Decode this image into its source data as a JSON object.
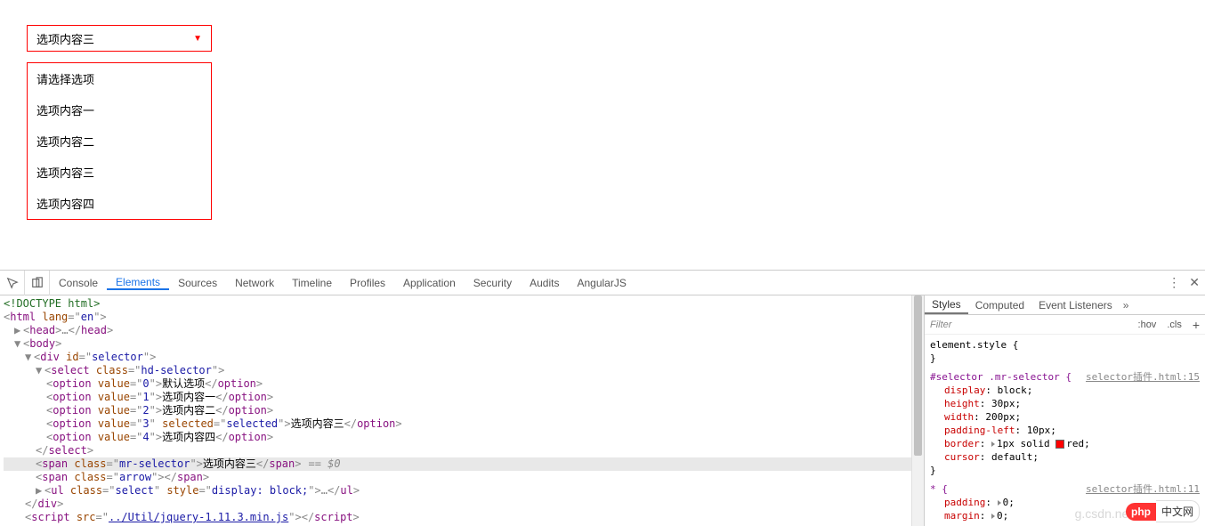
{
  "selector": {
    "selected": "选项内容三",
    "options": [
      "请选择选项",
      "选项内容一",
      "选项内容二",
      "选项内容三",
      "选项内容四"
    ]
  },
  "devtools": {
    "tabs": [
      "Console",
      "Elements",
      "Sources",
      "Network",
      "Timeline",
      "Profiles",
      "Application",
      "Security",
      "Audits",
      "AngularJS"
    ],
    "active_tab": "Elements",
    "elements": {
      "doctype": "<!DOCTYPE html>",
      "html_open": {
        "tag": "html",
        "attr": "lang",
        "val": "en"
      },
      "head": "<head>…</head>",
      "body": "<body>",
      "div_open": {
        "tag": "div",
        "attr": "id",
        "val": "selector"
      },
      "select_open": {
        "tag": "select",
        "attr": "class",
        "val": "hd-selector"
      },
      "opts": [
        {
          "value": "0",
          "text": "默认选项",
          "selected": false
        },
        {
          "value": "1",
          "text": "选项内容一",
          "selected": false
        },
        {
          "value": "2",
          "text": "选项内容二",
          "selected": false
        },
        {
          "value": "3",
          "text": "选项内容三",
          "selected": true
        },
        {
          "value": "4",
          "text": "选项内容四",
          "selected": false
        }
      ],
      "select_close": "</select>",
      "span_mr": {
        "tag": "span",
        "attr": "class",
        "val": "mr-selector",
        "text": "选项内容三"
      },
      "eqsel": "== $0",
      "span_arrow": {
        "tag": "span",
        "attr": "class",
        "val": "arrow"
      },
      "ul": {
        "tag": "ul",
        "attr": "class",
        "val": "select",
        "style_attr": "style",
        "style_val": "display: block;"
      },
      "div_close": "</div>",
      "script": {
        "tag": "script",
        "attr": "src",
        "val": "../Util/jquery-1.11.3.min.js"
      }
    },
    "styles": {
      "tabs": [
        "Styles",
        "Computed",
        "Event Listeners"
      ],
      "filter_placeholder": "Filter",
      "hov": ":hov",
      "cls": ".cls",
      "el_style": "element.style {",
      "close": "}",
      "rule1_sel": "#selector .mr-selector {",
      "rule1_src": "selector插件.html:15",
      "rule1_props": [
        {
          "k": "display",
          "v": "block;"
        },
        {
          "k": "height",
          "v": "30px;"
        },
        {
          "k": "width",
          "v": "200px;"
        },
        {
          "k": "padding-left",
          "v": "10px;"
        },
        {
          "k": "border",
          "v": "1px solid ",
          "swatch": true,
          "v2": "red;"
        },
        {
          "k": "cursor",
          "v": "default;"
        }
      ],
      "rule2_sel": "* {",
      "rule2_src": "selector插件.html:11",
      "rule2_props": [
        {
          "k": "padding",
          "v": "0;",
          "tri": true
        },
        {
          "k": "margin",
          "v": "0;",
          "tri": true
        }
      ]
    }
  },
  "watermark": "g.csdn.net/Co",
  "badge": {
    "left": "php",
    "right": "中文网"
  }
}
